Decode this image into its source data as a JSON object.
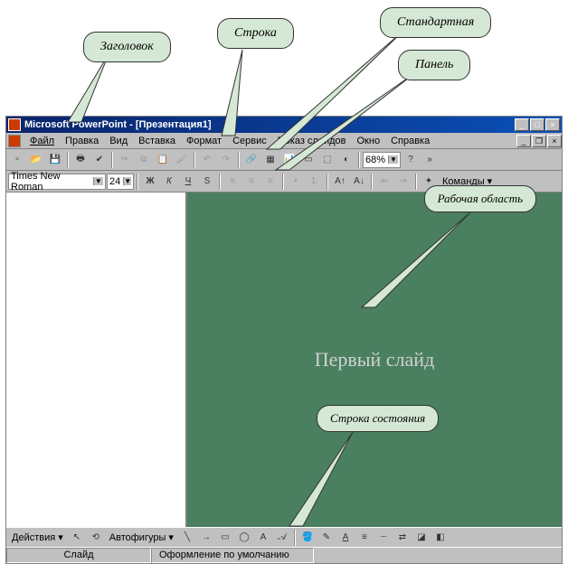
{
  "callouts": {
    "title": "Заголовок",
    "menubar": "Строка",
    "standard_toolbar": "Стандартная",
    "panel": "Панель",
    "workarea": "Рабочая область",
    "statusbar": "Строка состояния"
  },
  "titlebar": {
    "app_name": "Microsoft PowerPoint",
    "doc_name": "[Презентация1]"
  },
  "menu": {
    "file": "Файл",
    "edit": "Правка",
    "view": "Вид",
    "insert": "Вставка",
    "format": "Формат",
    "tools": "Сервис",
    "slideshow": "Показ слайдов",
    "window": "Окно",
    "help": "Справка"
  },
  "toolbar": {
    "zoom": "68%",
    "commands": "Команды"
  },
  "format_toolbar": {
    "font_name": "Times New Roman",
    "font_size": "24",
    "bold": "Ж",
    "italic": "К",
    "underline": "Ч"
  },
  "slide": {
    "placeholder_text": "Первый слайд"
  },
  "draw_toolbar": {
    "actions": "Действия",
    "autoshapes": "Автофигуры"
  },
  "status": {
    "slide_label": "Слайд",
    "design_label": "Оформление по умолчанию"
  }
}
